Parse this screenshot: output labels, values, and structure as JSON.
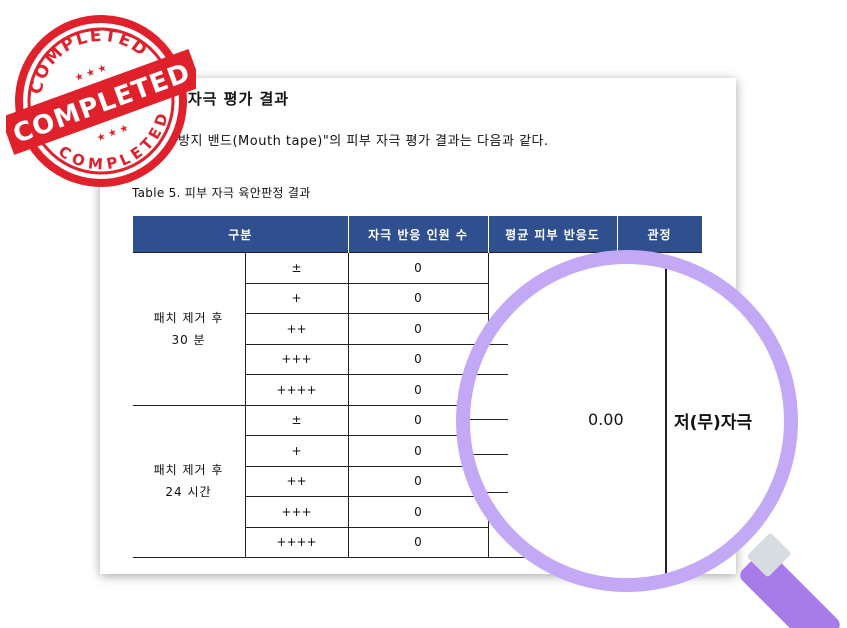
{
  "document": {
    "heading": "피부 자극 평가 결과",
    "intro": "입마름 방지 밴드(Mouth tape)\"의 피부 자극 평가 결과는 다음과 같다.",
    "caption": "Table 5. 피부 자극 육안판정 결과"
  },
  "table": {
    "headers": [
      "구분",
      "자극 반응 인원 수",
      "평균 피부 반응도",
      "관정"
    ],
    "groups": [
      {
        "label_line1": "패치 제거 후",
        "label_line2": "30 분",
        "rows": [
          {
            "grade": "±",
            "count": "0"
          },
          {
            "grade": "+",
            "count": "0"
          },
          {
            "grade": "++",
            "count": "0"
          },
          {
            "grade": "+++",
            "count": "0"
          },
          {
            "grade": "++++",
            "count": "0"
          }
        ]
      },
      {
        "label_line1": "패치 제거 후",
        "label_line2": "24 시간",
        "rows": [
          {
            "grade": "±",
            "count": "0"
          },
          {
            "grade": "+",
            "count": "0"
          },
          {
            "grade": "++",
            "count": "0"
          },
          {
            "grade": "+++",
            "count": "0"
          },
          {
            "grade": "++++",
            "count": "0"
          }
        ]
      }
    ]
  },
  "magnifier": {
    "value": "0.00",
    "judgement": "저(무)자극"
  },
  "stamp": {
    "top_text": "COMPLETED",
    "center_text": "COMPLETED",
    "bottom_text": "COMPLETED",
    "color": "#e0202b"
  },
  "colors": {
    "header_bg": "#2f4f8f",
    "lens_ring": "#c3a8f5",
    "handle": "#a87ce8"
  }
}
